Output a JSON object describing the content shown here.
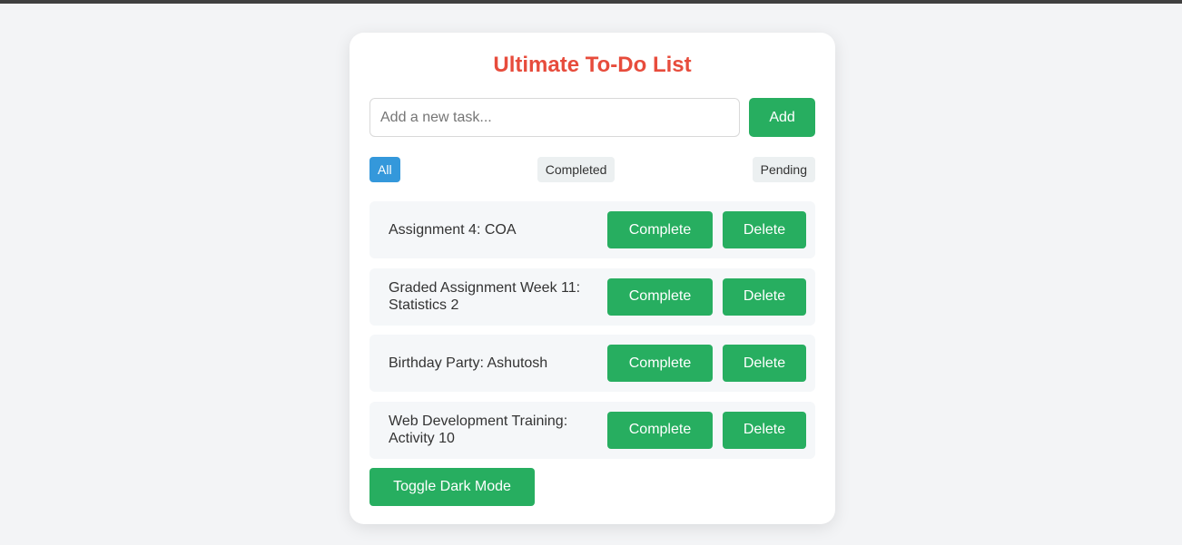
{
  "app": {
    "title": "Ultimate To-Do List"
  },
  "input": {
    "placeholder": "Add a new task...",
    "value": "",
    "add_label": "Add"
  },
  "filters": [
    {
      "label": "All",
      "active": true
    },
    {
      "label": "Completed",
      "active": false
    },
    {
      "label": "Pending",
      "active": false
    }
  ],
  "tasks": [
    {
      "text": "Assignment 4: COA",
      "complete_label": "Complete",
      "delete_label": "Delete"
    },
    {
      "text": "Graded Assignment Week 11: Statistics 2",
      "complete_label": "Complete",
      "delete_label": "Delete"
    },
    {
      "text": "Birthday Party: Ashutosh",
      "complete_label": "Complete",
      "delete_label": "Delete"
    },
    {
      "text": "Web Development Training: Activity 10",
      "complete_label": "Complete",
      "delete_label": "Delete"
    }
  ],
  "footer": {
    "toggle_label": "Toggle Dark Mode"
  },
  "colors": {
    "title": "#e74c3c",
    "primary_button": "#27ae60",
    "active_filter": "#3498db",
    "inactive_filter": "#ecf0f1",
    "task_background": "#f5f7f9",
    "page_background": "#f3f4f6"
  }
}
